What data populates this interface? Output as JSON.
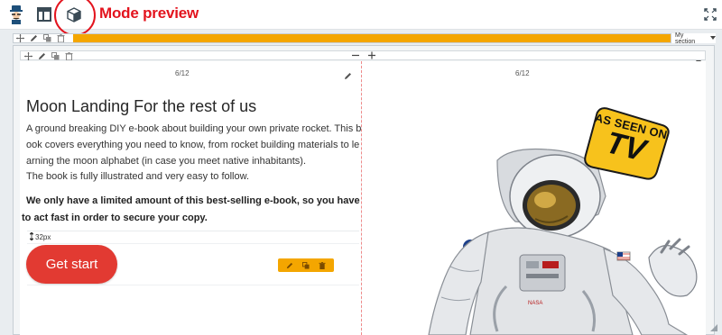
{
  "toolbar": {
    "annotation_label": "Mode preview",
    "icons": [
      "logo-icon",
      "layout-icon",
      "cube-icon",
      "fullscreen-icon"
    ]
  },
  "section": {
    "select_value": "My section"
  },
  "columns": {
    "left_size": "6/12",
    "right_size": "6/12"
  },
  "content": {
    "heading": "Moon Landing For the rest of us",
    "paragraph1": "A ground breaking DIY e-book about building your own private rocket. This book covers everything you need to know, from rocket building materials to learning the moon alphabet (in case you meet native inhabitants).",
    "paragraph2": "The book is fully illustrated and very easy to follow.",
    "paragraph3": "We only have a limited amount of this best-selling e-book, so you have to act fast in order to secure your copy.",
    "spacer": "32px",
    "cta_label": "Get start"
  },
  "badge": {
    "line1": "AS SEEN ON",
    "line2": "TV"
  },
  "colors": {
    "accent_orange": "#f4a600",
    "cta_red": "#e23a32",
    "annotation_red": "#e3141e",
    "badge_yellow": "#f7c21c"
  }
}
